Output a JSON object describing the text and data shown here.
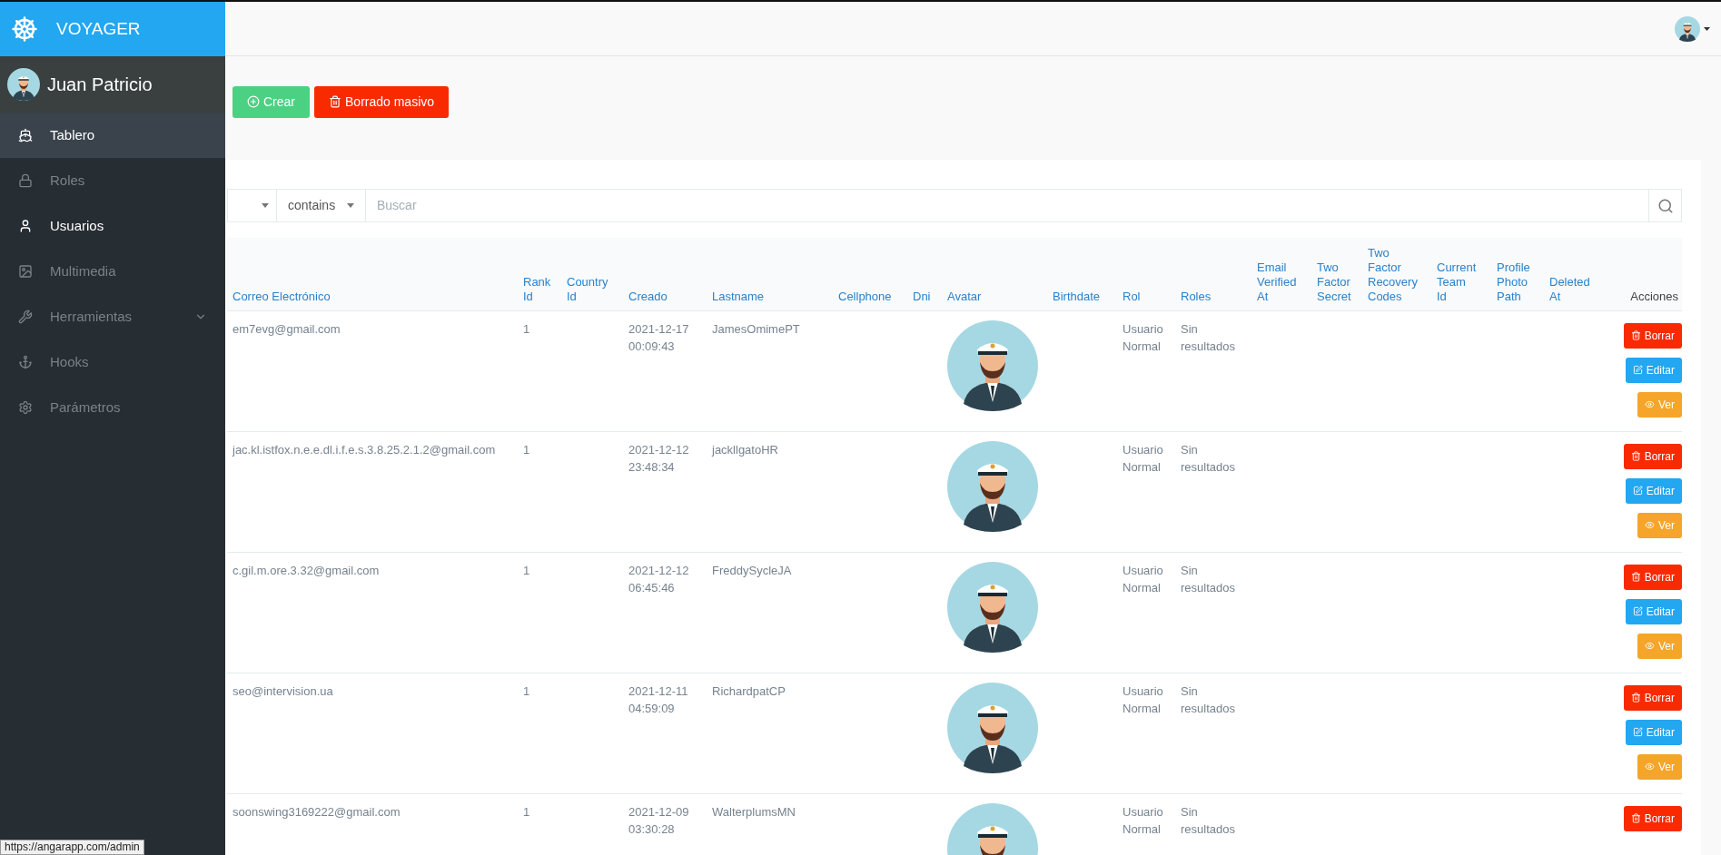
{
  "brand": {
    "title": "VOYAGER"
  },
  "user": {
    "name": "Juan Patricio"
  },
  "sidebar": {
    "items": [
      {
        "label": "Tablero",
        "selected": true,
        "active": true,
        "expandable": false
      },
      {
        "label": "Roles",
        "selected": false,
        "active": false,
        "expandable": false
      },
      {
        "label": "Usuarios",
        "selected": false,
        "active": true,
        "expandable": false
      },
      {
        "label": "Multimedia",
        "selected": false,
        "active": false,
        "expandable": false
      },
      {
        "label": "Herramientas",
        "selected": false,
        "active": false,
        "expandable": true
      },
      {
        "label": "Hooks",
        "selected": false,
        "active": false,
        "expandable": false
      },
      {
        "label": "Parámetros",
        "selected": false,
        "active": false,
        "expandable": false
      }
    ]
  },
  "toolbar": {
    "buttons": [
      {
        "label": "Crear",
        "kind": "create"
      },
      {
        "label": "Borrado masivo",
        "kind": "bulk-delete"
      }
    ]
  },
  "filter": {
    "operator": "contains",
    "placeholder": "Buscar"
  },
  "table": {
    "columns": [
      "Correo Electrónico",
      "Rank Id",
      "Country Id",
      "Creado",
      "Lastname",
      "Cellphone",
      "Dni",
      "Avatar",
      "Birthdate",
      "Rol",
      "Roles",
      "Email Verified At",
      "Two Factor Secret",
      "Two Factor Recovery Codes",
      "Current Team Id",
      "Profile Photo Path",
      "Deleted At",
      "Acciones"
    ],
    "rows": [
      {
        "email": "em7evg@gmail.com",
        "rank_id": "1",
        "created": "2021-12-17 00:09:43",
        "lastname": "JamesOmimePT",
        "rol": "Usuario Normal",
        "roles": "Sin resultados",
        "actions": [
          {
            "label": "Borrar",
            "kind": "delete"
          },
          {
            "label": "Editar",
            "kind": "edit"
          },
          {
            "label": "Ver",
            "kind": "view"
          }
        ]
      },
      {
        "email": "jac.kl.istfox.n.e.e.dl.i.f.e.s.3.8.25.2.1.2@gmail.com",
        "rank_id": "1",
        "created": "2021-12-12 23:48:34",
        "lastname": "jackllgatoHR",
        "rol": "Usuario Normal",
        "roles": "Sin resultados",
        "actions": [
          {
            "label": "Borrar",
            "kind": "delete"
          },
          {
            "label": "Editar",
            "kind": "edit"
          },
          {
            "label": "Ver",
            "kind": "view"
          }
        ]
      },
      {
        "email": "c.gil.m.ore.3.32@gmail.com",
        "rank_id": "1",
        "created": "2021-12-12 06:45:46",
        "lastname": "FreddySycleJA",
        "rol": "Usuario Normal",
        "roles": "Sin resultados",
        "actions": [
          {
            "label": "Borrar",
            "kind": "delete"
          },
          {
            "label": "Editar",
            "kind": "edit"
          },
          {
            "label": "Ver",
            "kind": "view"
          }
        ]
      },
      {
        "email": "seo@intervision.ua",
        "rank_id": "1",
        "created": "2021-12-11 04:59:09",
        "lastname": "RichardpatCP",
        "rol": "Usuario Normal",
        "roles": "Sin resultados",
        "actions": [
          {
            "label": "Borrar",
            "kind": "delete"
          },
          {
            "label": "Editar",
            "kind": "edit"
          },
          {
            "label": "Ver",
            "kind": "view"
          }
        ]
      },
      {
        "email": "soonswing3169222@gmail.com",
        "rank_id": "1",
        "created": "2021-12-09 03:30:28",
        "lastname": "WalterplumsMN",
        "rol": "Usuario Normal",
        "roles": "Sin resultados",
        "actions": [
          {
            "label": "Borrar",
            "kind": "delete"
          }
        ]
      }
    ]
  },
  "status_url": "https://angarapp.com/admin"
}
